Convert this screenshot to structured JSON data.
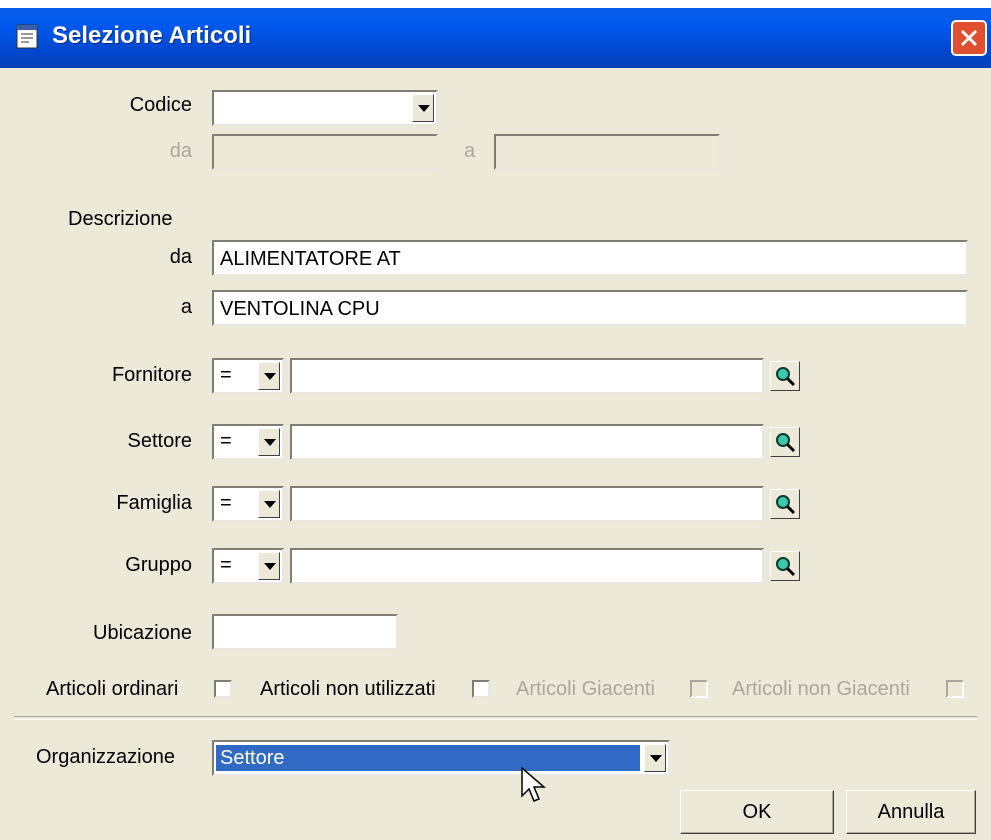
{
  "window": {
    "title": "Selezione Articoli"
  },
  "codice": {
    "label": "Codice",
    "value": "",
    "da_label": "da",
    "a_label": "a",
    "da_value": "",
    "a_value": ""
  },
  "descrizione": {
    "label": "Descrizione",
    "da_label": "da",
    "a_label": "a",
    "da_value": "ALIMENTATORE AT",
    "a_value": "VENTOLINA CPU"
  },
  "filters": [
    {
      "label": "Fornitore",
      "operator": "=",
      "value": ""
    },
    {
      "label": "Settore",
      "operator": "=",
      "value": ""
    },
    {
      "label": "Famiglia",
      "operator": "=",
      "value": ""
    },
    {
      "label": "Gruppo",
      "operator": "=",
      "value": ""
    }
  ],
  "ubicazione": {
    "label": "Ubicazione",
    "value": ""
  },
  "checkboxes": [
    {
      "label": "Articoli ordinari",
      "checked": false,
      "enabled": true
    },
    {
      "label": "Articoli non utilizzati",
      "checked": false,
      "enabled": true
    },
    {
      "label": "Articoli Giacenti",
      "checked": false,
      "enabled": false
    },
    {
      "label": "Articoli non Giacenti",
      "checked": false,
      "enabled": false
    }
  ],
  "organizzazione": {
    "label": "Organizzazione",
    "value": "Settore"
  },
  "buttons": {
    "ok": "OK",
    "cancel": "Annulla"
  },
  "icons": {
    "title": "app-window-icon",
    "close": "close-icon",
    "lookup": "magnifier-icon"
  },
  "colors": {
    "titlebar": "#0058ee",
    "selection": "#316ac5",
    "background": "#ece9d8"
  }
}
